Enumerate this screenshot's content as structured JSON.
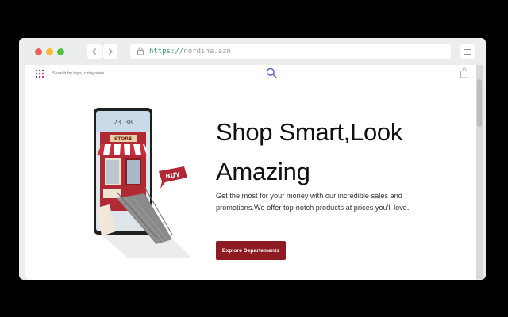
{
  "browser": {
    "url_scheme": "https://",
    "url_host": "nordine.azn",
    "back_icon": "chevron-left-icon",
    "forward_icon": "chevron-right-icon",
    "lock_icon": "lock-icon",
    "menu_icon": "menu-icon"
  },
  "header": {
    "search_placeholder": "Search by tags, categories...",
    "grid_icon": "grid-icon",
    "search_icon": "search-icon",
    "bag_icon": "shopping-bag-icon"
  },
  "illustration": {
    "clock": "23 38",
    "store_sign": "STORE",
    "speech_bubble": "BUY"
  },
  "hero": {
    "title_line1": "Shop Smart,Look",
    "title_line2": "Amazing",
    "description": "Get the most for your money with our incredible sales and promotions.We offer top-notch products at prices you'll love.",
    "cta_label": "Explore Departements"
  },
  "colors": {
    "accent": "#8e1a22",
    "url_scheme": "#2f9a70",
    "search_icon": "#3b57d6"
  }
}
